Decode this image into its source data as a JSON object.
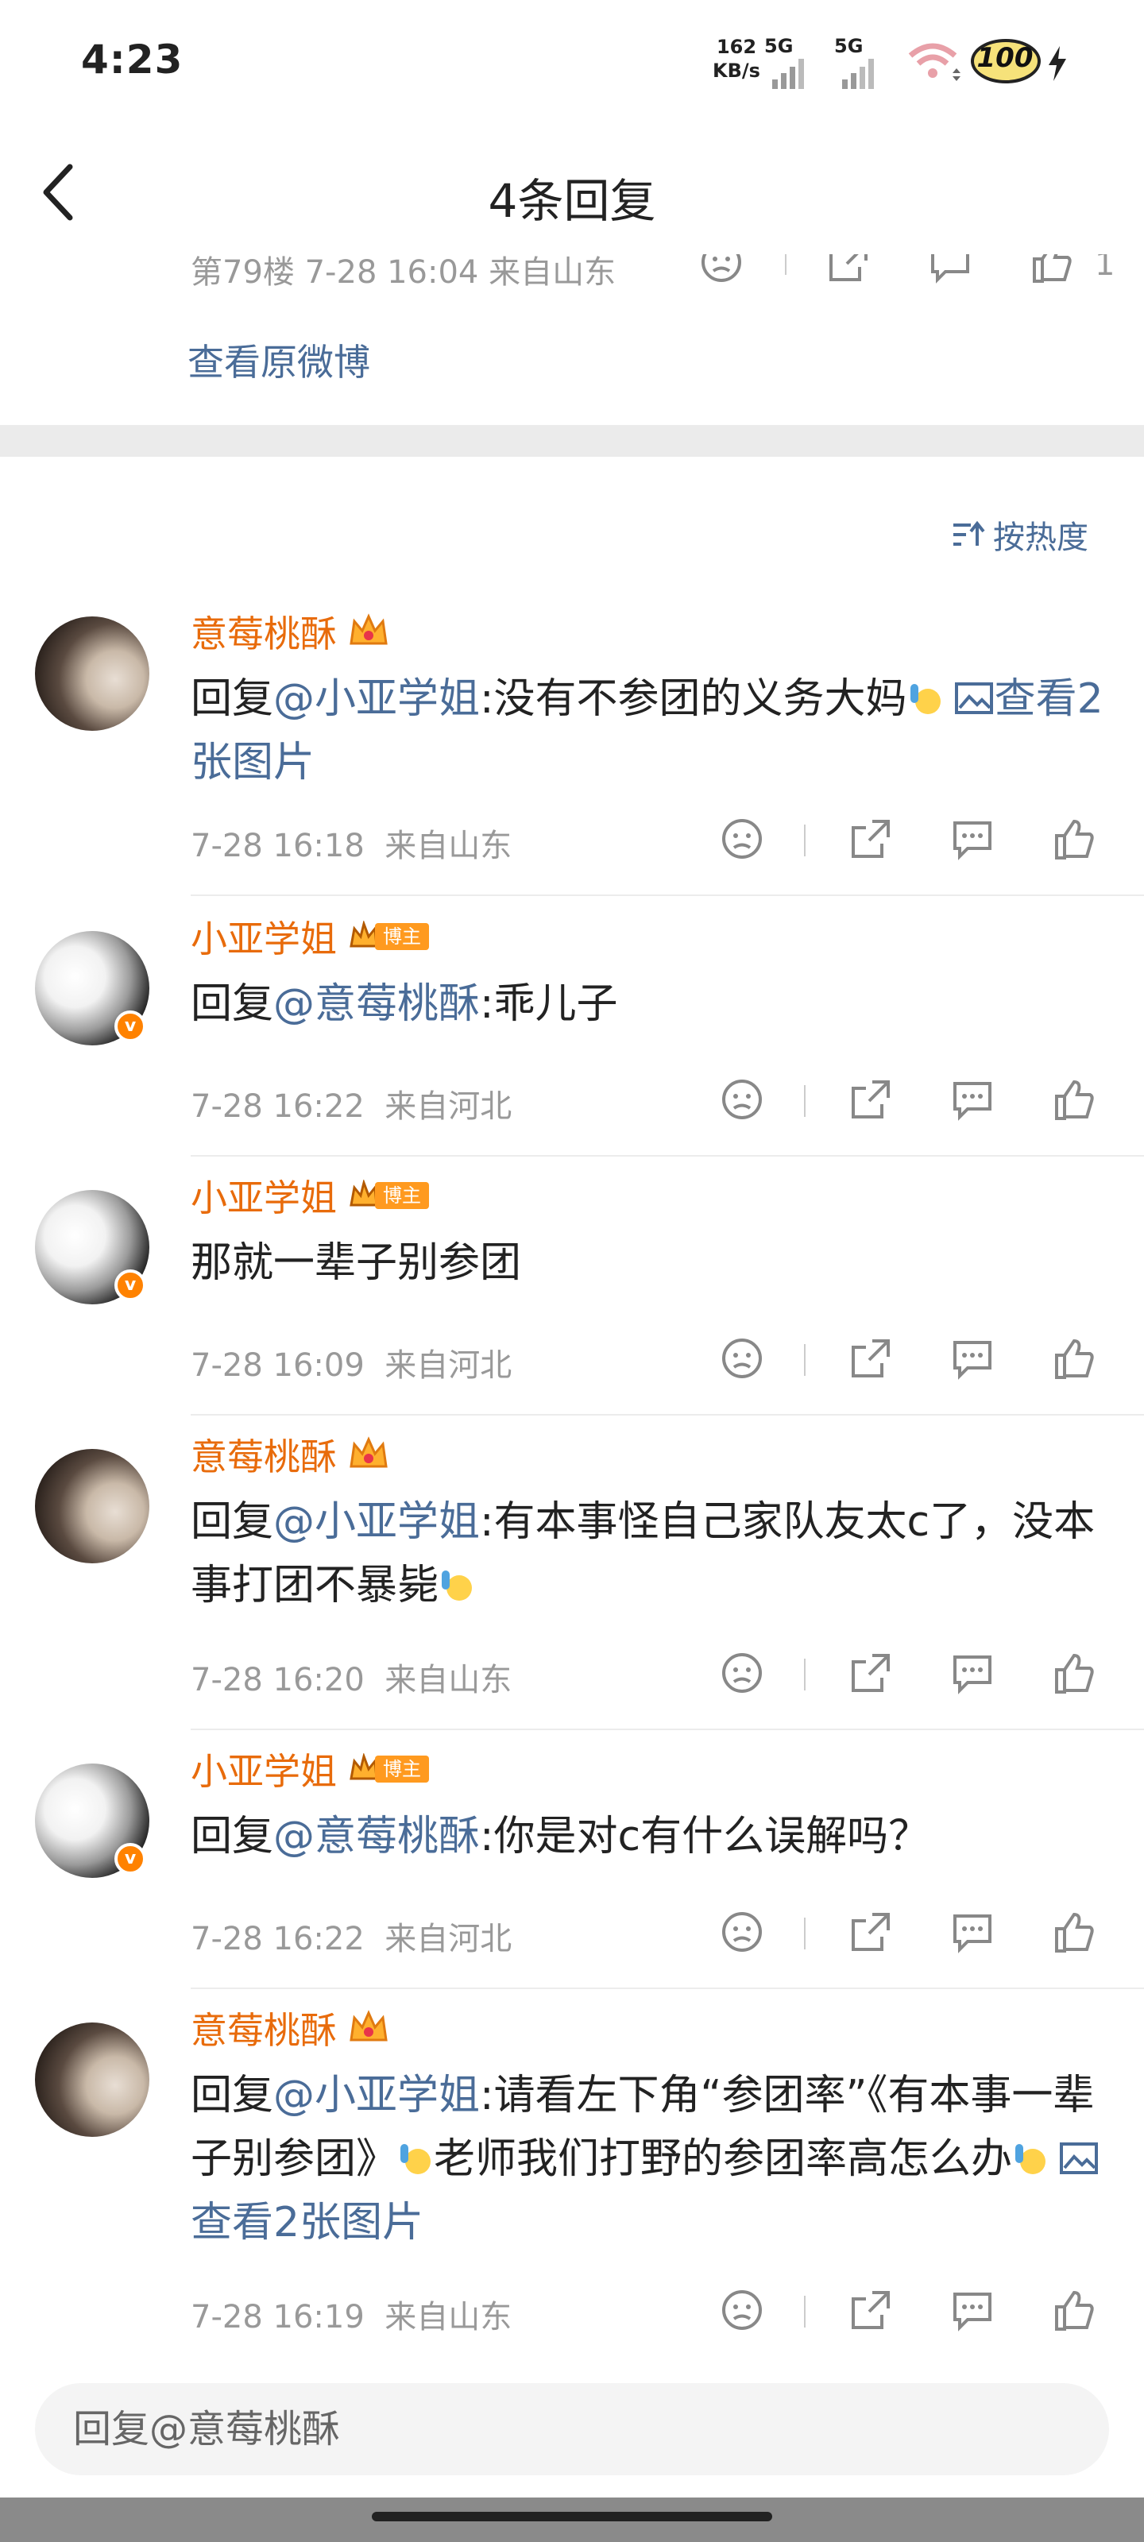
{
  "status_bar": {
    "time": "4:23",
    "net_speed_value": "162",
    "net_speed_unit": "KB/s",
    "signal1": "5G",
    "signal2": "5G",
    "battery": "100"
  },
  "nav": {
    "title": "4条回复"
  },
  "top_card": {
    "partial_meta": "第79楼  7-28 16:04  来自山东",
    "partial_like_count": "1",
    "view_original": "查看原微博"
  },
  "sort": {
    "label": "按热度"
  },
  "comments": [
    {
      "username": "意莓桃酥",
      "reply_prefix": "回复",
      "mention": "@小亚学姐",
      "text": ":没有不参团的义务大妈",
      "link": "查看2张图片",
      "time": "7-28 16:18",
      "location": "来自山东"
    },
    {
      "username": "小亚学姐",
      "badge": "博主",
      "reply_prefix": "回复",
      "mention": "@意莓桃酥",
      "text": ":乖儿子",
      "time": "7-28 16:22",
      "location": "来自河北"
    },
    {
      "username": "小亚学姐",
      "badge": "博主",
      "text": "那就一辈子别参团",
      "time": "7-28 16:09",
      "location": "来自河北"
    },
    {
      "username": "意莓桃酥",
      "reply_prefix": "回复",
      "mention": "@小亚学姐",
      "text": ":有本事怪自己家队友太c了，没本事打团不暴毙",
      "time": "7-28 16:20",
      "location": "来自山东"
    },
    {
      "username": "小亚学姐",
      "badge": "博主",
      "reply_prefix": "回复",
      "mention": "@意莓桃酥",
      "text": ":你是对c有什么误解吗？",
      "time": "7-28 16:22",
      "location": "来自河北"
    },
    {
      "username": "意莓桃酥",
      "reply_prefix": "回复",
      "mention": "@小亚学姐",
      "text": ":请看左下角“参团率”《有本事一辈子别参团》",
      "text2": "老师我们打野的参团率高怎么办",
      "link": "查看2张图片",
      "time": "7-28 16:19",
      "location": "来自山东"
    }
  ],
  "reply_bar": {
    "placeholder": "回复@意莓桃酥"
  },
  "icons": {
    "dislike": "frown-face-icon",
    "share": "share-icon",
    "comment": "comment-bubble-icon",
    "like": "thumbs-up-icon",
    "image": "image-icon",
    "crown": "crown-icon",
    "emoji": "raise-hand-emoji-icon"
  },
  "colors": {
    "username": "#e86b0b",
    "link": "#4a6c98",
    "meta": "#999999",
    "badge": "#ff9a1f"
  }
}
